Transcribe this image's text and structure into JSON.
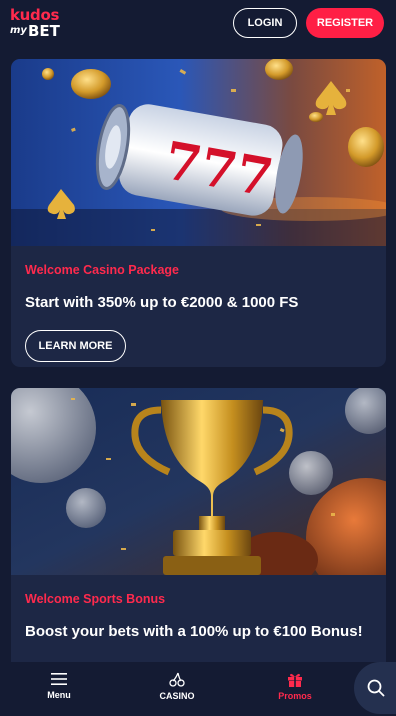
{
  "header": {
    "logo_top": "kudos",
    "logo_my": "my",
    "logo_bet": "BET",
    "login_label": "LOGIN",
    "register_label": "REGISTER"
  },
  "cards": [
    {
      "eyebrow": "Welcome Casino Package",
      "title": "Start with 350% up to €2000 & 1000 FS",
      "button_label": "LEARN MORE",
      "image_icon": "slot-machine-777"
    },
    {
      "eyebrow": "Welcome Sports Bonus",
      "title": "Boost your bets with a 100% up to €100 Bonus!",
      "image_icon": "gold-trophy"
    }
  ],
  "bottom_nav": {
    "items": [
      {
        "label": "Menu",
        "icon": "hamburger-icon"
      },
      {
        "label": "CASINO",
        "icon": "cherry-icon"
      },
      {
        "label": "Promos",
        "icon": "gift-icon",
        "active": true
      }
    ],
    "search_icon": "search-icon"
  },
  "colors": {
    "background": "#141b33",
    "card": "#1d2745",
    "accent": "#ff1f45"
  }
}
